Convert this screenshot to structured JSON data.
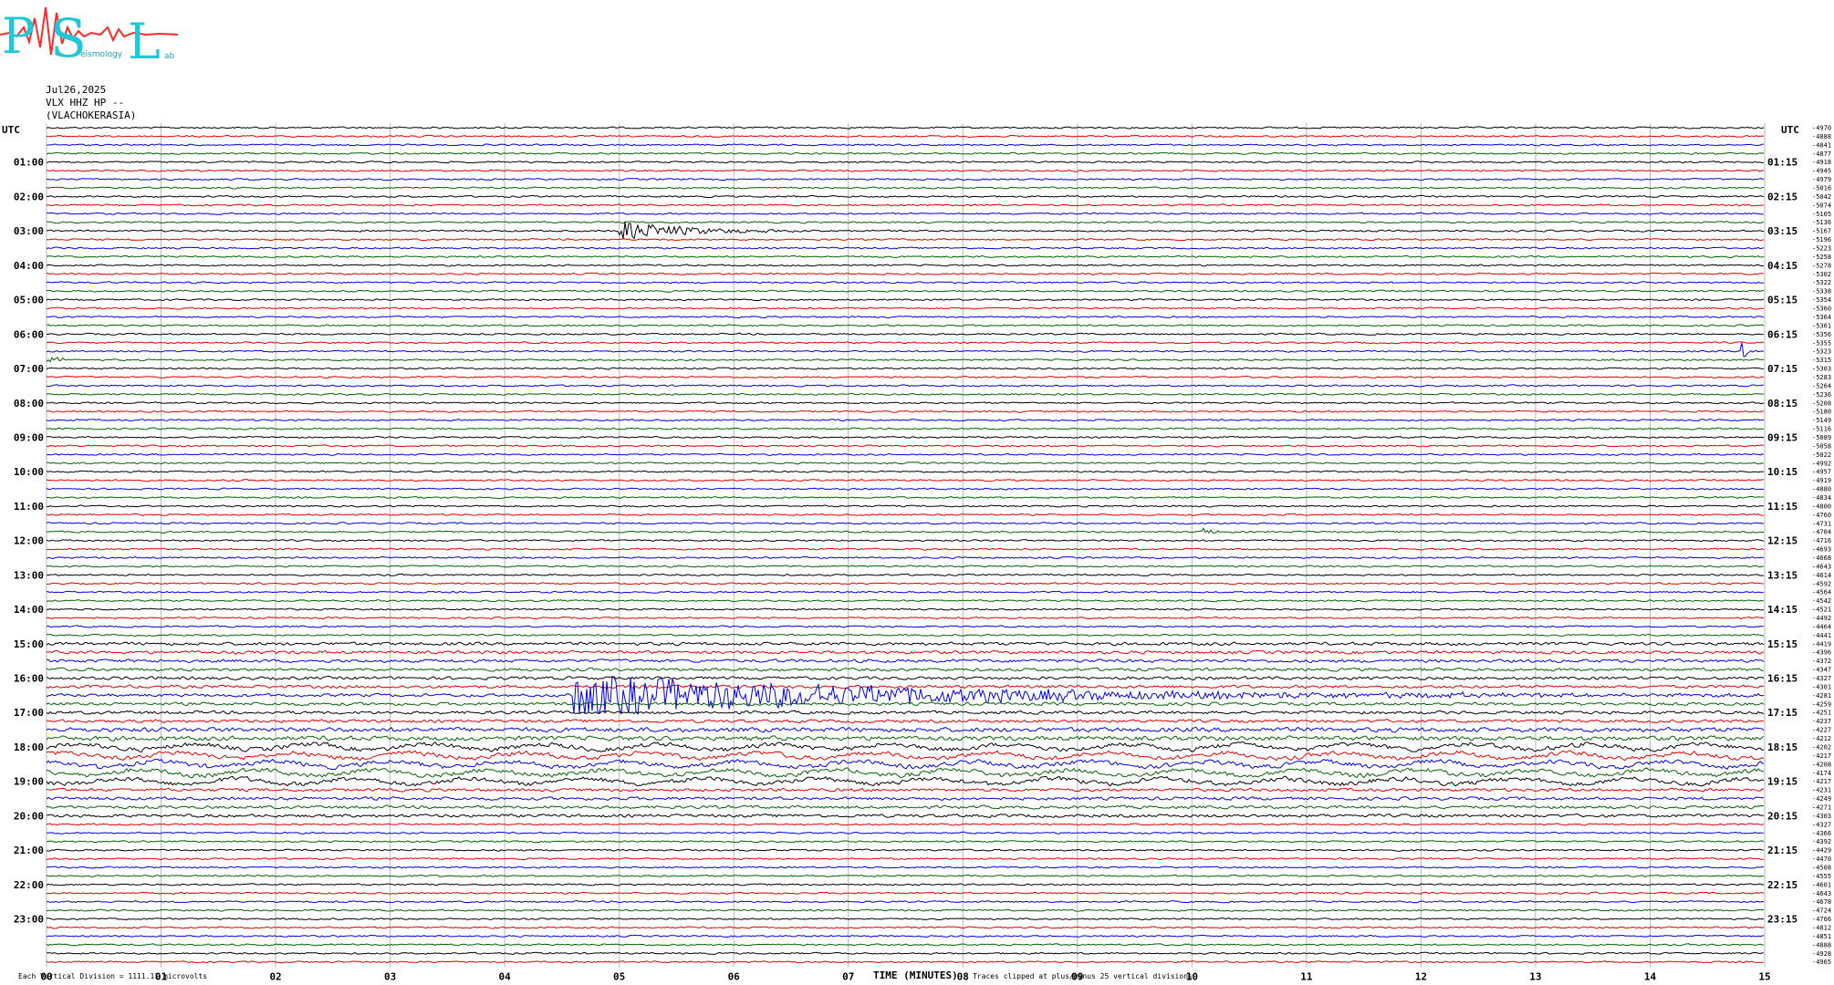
{
  "logo": {
    "letters": [
      "P",
      "S",
      "L"
    ],
    "small_text": [
      "eismology",
      "ab"
    ],
    "colors": {
      "letters": "#1ec8d8",
      "signal": "#ff2a2a"
    }
  },
  "header": {
    "date": "Jul26,2025",
    "station": "VLX HHZ HP --",
    "location": "(VLACHOKERASIA)"
  },
  "axis_units": {
    "left": "UTC",
    "right": "UTC"
  },
  "footer": {
    "left_note": "Each Vertical Division = 1111.11 microvolts",
    "x_title": "TIME (MINUTES)",
    "clip_note": "Traces clipped at plus/minus 25 vertical divisions"
  },
  "chart_data": {
    "type": "helicorder",
    "x_ticks": [
      "00",
      "01",
      "02",
      "03",
      "04",
      "05",
      "06",
      "07",
      "08",
      "09",
      "10",
      "11",
      "12",
      "13",
      "14",
      "15"
    ],
    "xlim": [
      0,
      15
    ],
    "xlabel": "TIME (MINUTES)",
    "traces_per_hour": 4,
    "trace_colors": [
      "#000000",
      "#e00000",
      "#0000e0",
      "#006400"
    ],
    "left_hour_labels": [
      "01:00",
      "02:00",
      "03:00",
      "04:00",
      "05:00",
      "06:00",
      "07:00",
      "08:00",
      "09:00",
      "10:00",
      "11:00",
      "12:00",
      "13:00",
      "14:00",
      "15:00",
      "16:00",
      "17:00",
      "18:00",
      "19:00",
      "20:00",
      "21:00",
      "22:00",
      "23:00"
    ],
    "right_hour_labels": [
      "01:15",
      "02:15",
      "03:15",
      "04:15",
      "05:15",
      "06:15",
      "07:15",
      "08:15",
      "09:15",
      "10:15",
      "11:15",
      "12:15",
      "13:15",
      "14:15",
      "15:15",
      "16:15",
      "17:15",
      "18:15",
      "19:15",
      "20:15",
      "21:15",
      "22:15",
      "23:15"
    ],
    "right_offsets": [
      "-4970",
      "-4888",
      "-4841",
      "-4877",
      "-4918",
      "-4945",
      "-4979",
      "-5016",
      "-5042",
      "-5074",
      "-5105",
      "-5136",
      "-5167",
      "-5196",
      "-5223",
      "-5258",
      "-5278",
      "-5302",
      "-5322",
      "-5338",
      "-5354",
      "-5360",
      "-5364",
      "-5361",
      "-5356",
      "-5355",
      "-5323",
      "-5315",
      "-5303",
      "-5283",
      "-5264",
      "-5236",
      "-5208",
      "-5180",
      "-5149",
      "-5116",
      "-5089",
      "-5058",
      "-5022",
      "-4992",
      "-4957",
      "-4919",
      "-4880",
      "-4834",
      "-4800",
      "-4760",
      "-4731",
      "-4704",
      "-4716",
      "-4693",
      "-4668",
      "-4643",
      "-4614",
      "-4592",
      "-4564",
      "-4542",
      "-4521",
      "-4492",
      "-4464",
      "-4441",
      "-4419",
      "-4396",
      "-4372",
      "-4347",
      "-4327",
      "-4301",
      "-4281",
      "-4259",
      "-4251",
      "-4237",
      "-4227",
      "-4212",
      "-4202",
      "-4217",
      "-4208",
      "-4174",
      "-4217",
      "-4231",
      "-4249",
      "-4271",
      "-4303",
      "-4327",
      "-4366",
      "-4392",
      "-4429",
      "-4470",
      "-4508",
      "-4555",
      "-4601",
      "-4643",
      "-4678",
      "-4724",
      "-4766",
      "-4812",
      "-4851",
      "-4888",
      "-4928",
      "-4965"
    ],
    "events": [
      {
        "trace": 12,
        "start_min": 5.0,
        "end_min": 7.0,
        "amplitude": 12,
        "color": "#000000"
      },
      {
        "trace": 26,
        "start_min": 14.8,
        "end_min": 15.0,
        "amplitude": 10,
        "color": "#0000e0"
      },
      {
        "trace": 27,
        "start_min": 0.0,
        "end_min": 0.3,
        "amplitude": 6,
        "color": "#006400"
      },
      {
        "trace": 47,
        "start_min": 10.1,
        "end_min": 10.4,
        "amplitude": 5,
        "color": "#000000"
      },
      {
        "trace": 66,
        "start_min": 4.6,
        "end_min": 15.0,
        "amplitude": 24,
        "color": "#0000e0"
      }
    ]
  }
}
